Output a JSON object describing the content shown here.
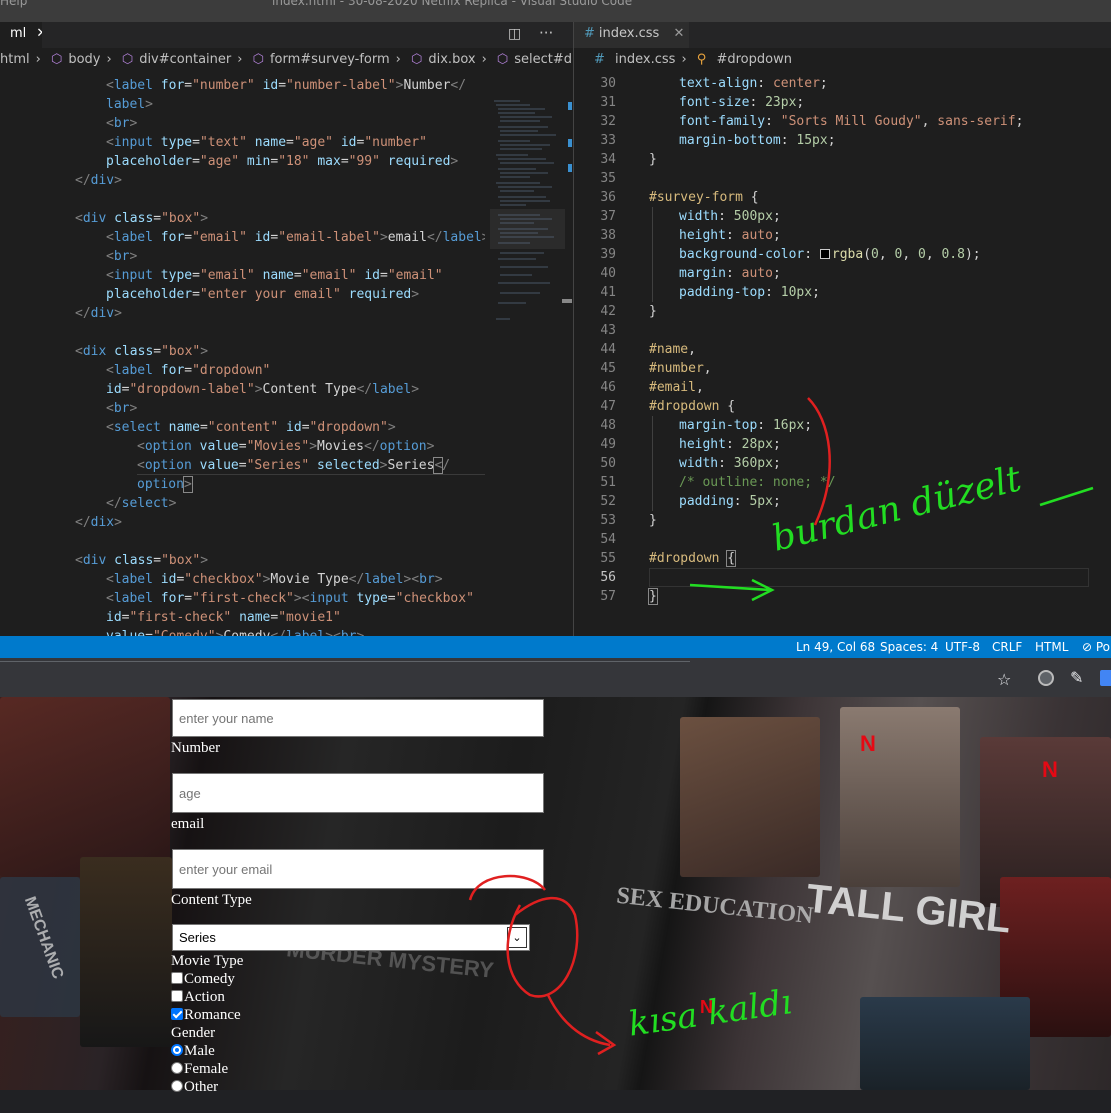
{
  "window": {
    "title": "index.html - 30-08-2020 Netflix Replica - Visual Studio Code",
    "menu_help": "Help"
  },
  "left_editor": {
    "tab_label": "ml",
    "breadcrumb": [
      "html",
      "body",
      "div#container",
      "form#survey-form",
      "dix.box",
      "select#dropdown"
    ]
  },
  "right_editor": {
    "tab_label": "index.css",
    "breadcrumb": [
      "index.css",
      "#dropdown"
    ],
    "line_numbers": [
      "30",
      "31",
      "32",
      "33",
      "34",
      "35",
      "36",
      "37",
      "38",
      "39",
      "40",
      "41",
      "42",
      "43",
      "44",
      "45",
      "46",
      "47",
      "48",
      "49",
      "50",
      "51",
      "52",
      "53",
      "54",
      "55",
      "56",
      "57"
    ]
  },
  "status_bar": {
    "position": "Ln 49, Col 68",
    "spaces": "Spaces: 4",
    "encoding": "UTF-8",
    "eol": "CRLF",
    "language": "HTML"
  },
  "form": {
    "name_placeholder": "enter your name",
    "number_label": "Number",
    "age_placeholder": "age",
    "email_label": "email",
    "email_placeholder": "enter your email",
    "content_label": "Content Type",
    "select_value": "Series",
    "movie_type_label": "Movie Type",
    "checkboxes": [
      "Comedy",
      "Action",
      "Romance"
    ],
    "gender_label": "Gender",
    "radios": [
      "Male",
      "Female",
      "Other"
    ]
  },
  "backdrop_texts": [
    "SEX EDUCATION",
    "TALL GIRL",
    "MURDER MYSTERY",
    "MECHANIC"
  ],
  "annotations": {
    "text_1": "burdan düzelt",
    "text_2": "kısa kaldı"
  },
  "colors": {
    "statusbar": "#007acc",
    "annotation_red": "#e02020",
    "annotation_green": "#22dd22",
    "radio_blue": "#0075ff"
  }
}
